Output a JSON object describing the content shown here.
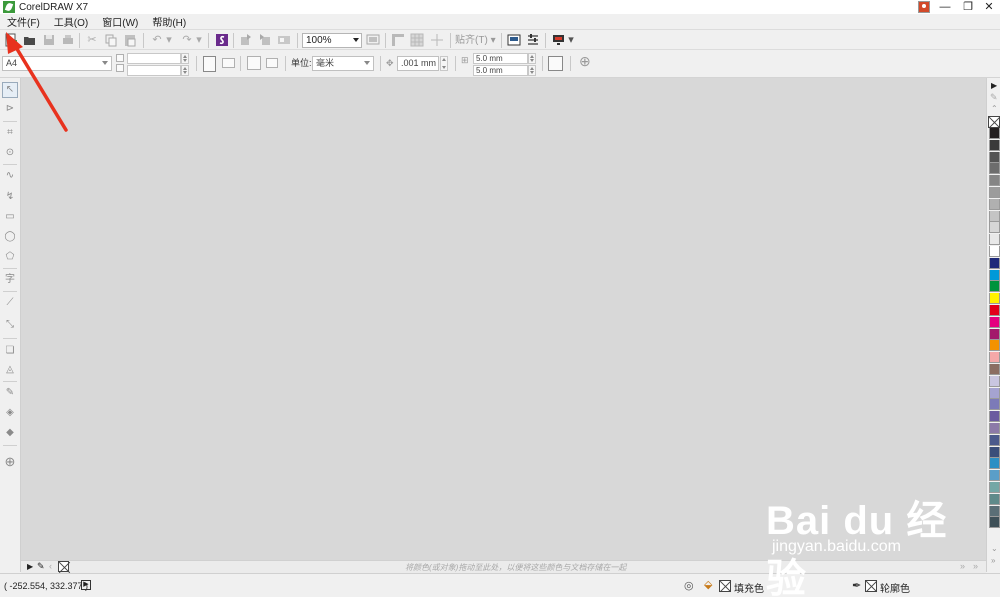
{
  "window": {
    "title": "CorelDRAW X7",
    "minimize": "—",
    "restore": "❐",
    "close": "✕"
  },
  "menu": {
    "items": [
      "文件(F)",
      "工具(O)",
      "窗口(W)",
      "帮助(H)"
    ]
  },
  "toolbar": {
    "zoom": "100%",
    "snap_label": "贴齐(T)",
    "icons": [
      "new-document-icon",
      "open-icon",
      "save-icon",
      "print-icon",
      "cut-icon",
      "copy-icon",
      "paste-icon",
      "undo-icon",
      "redo-icon",
      "search-content-icon",
      "import-icon",
      "export-icon",
      "publish-pdf-icon",
      "full-screen-preview-icon",
      "show-rulers-icon",
      "show-grid-icon",
      "show-guidelines-icon",
      "welcome-screen-icon",
      "options-icon",
      "launcher-icon"
    ]
  },
  "property_bar": {
    "page_size": "A4",
    "unit_label": "单位:",
    "unit_value": "毫米",
    "nudge": ".001 mm",
    "dup_x": "5.0 mm",
    "dup_y": "5.0 mm"
  },
  "toolbox": {
    "tools": [
      "pick-tool",
      "shape-tool",
      "crop-tool",
      "zoom-tool",
      "freehand-tool",
      "artistic-media-tool",
      "rectangle-tool",
      "ellipse-tool",
      "polygon-tool",
      "text-tool",
      "parallel-dimension-tool",
      "straight-connector-tool",
      "drop-shadow-tool",
      "transparency-tool",
      "color-eyedropper-tool",
      "interactive-fill-tool",
      "smart-fill-tool",
      "add-tool"
    ]
  },
  "palette": {
    "colors": [
      "#231f20",
      "#3a3a3a",
      "#545454",
      "#6d6d6d",
      "#858585",
      "#9c9c9c",
      "#b0b0b0",
      "#c4c4c4",
      "#d6d6d6",
      "#e8e8e8",
      "#ffffff",
      "#1f2a7a",
      "#0099d8",
      "#00933d",
      "#fff200",
      "#e2001a",
      "#e4007f",
      "#a3196b",
      "#f39200",
      "#f4a8a8",
      "#8b6e63",
      "#c9c6e0",
      "#a5a3d1",
      "#7c7ab8",
      "#6a5aa0",
      "#8c7aa8",
      "#4b5a8c",
      "#3a4e7a",
      "#2d8fc4",
      "#5a9ec8",
      "#74a7a6",
      "#5f8a8a",
      "#5a6e76",
      "#3e5058"
    ]
  },
  "doc_palette": {
    "hint": "将颜色(或对象)拖动至此处，以便将这些颜色与文档存储在一起"
  },
  "status": {
    "coords": "( -252.554, 332.377 )",
    "fill_label": "填充色",
    "outline_label": "轮廓色"
  },
  "watermark": {
    "logo": "Bai du 经验",
    "url": "jingyan.baidu.com"
  }
}
